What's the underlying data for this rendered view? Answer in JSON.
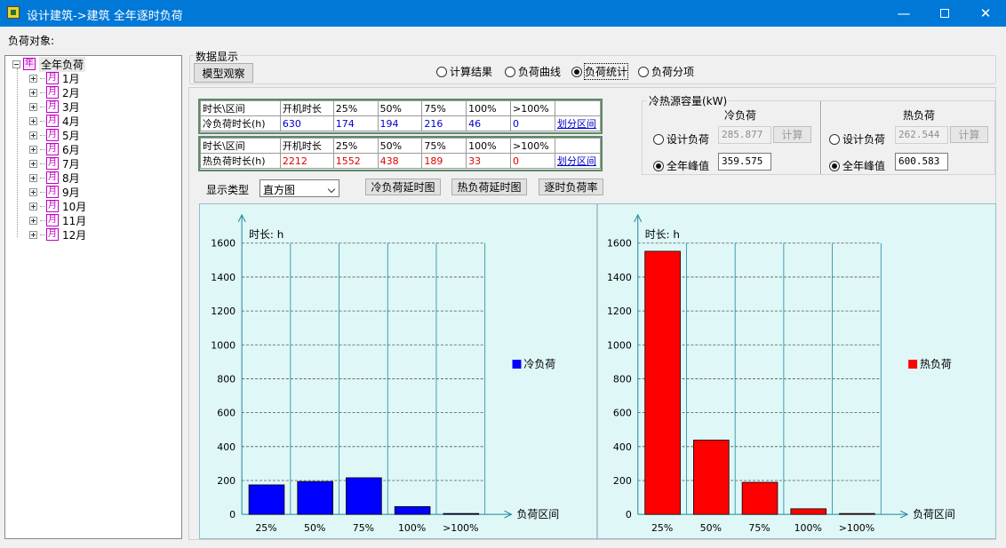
{
  "window": {
    "title": "设计建筑->建筑 全年逐时负荷"
  },
  "load_object_label": "负荷对象:",
  "tree": {
    "root": "全年负荷",
    "root_icon": "年",
    "month_icon": "月",
    "months": [
      "1月",
      "2月",
      "3月",
      "4月",
      "5月",
      "6月",
      "7月",
      "8月",
      "9月",
      "10月",
      "11月",
      "12月"
    ]
  },
  "data_display": {
    "group_title": "数据显示",
    "model_button": "模型观察",
    "options": [
      "计算结果",
      "负荷曲线",
      "负荷统计",
      "负荷分项"
    ],
    "selected": "负荷统计"
  },
  "cool_table": {
    "headers": [
      "时长\\区间",
      "开机时长",
      "25%",
      "50%",
      "75%",
      "100%",
      ">100%",
      ""
    ],
    "row_label": "冷负荷时长(h)",
    "values": [
      "630",
      "174",
      "194",
      "216",
      "46",
      "0"
    ],
    "link": "划分区间",
    "color": "#0000cc"
  },
  "heat_table": {
    "headers": [
      "时长\\区间",
      "开机时长",
      "25%",
      "50%",
      "75%",
      "100%",
      ">100%",
      ""
    ],
    "row_label": "热负荷时长(h)",
    "values": [
      "2212",
      "1552",
      "438",
      "189",
      "33",
      "0"
    ],
    "link": "划分区间",
    "color": "#e00000"
  },
  "capacity": {
    "title": "冷热源容量(kW)",
    "cool": {
      "heading": "冷负荷",
      "design_label": "设计负荷",
      "design_value": "285.877",
      "calc_button": "计算",
      "peak_label": "全年峰值",
      "peak_value": "359.575",
      "selected": "全年峰值"
    },
    "heat": {
      "heading": "热负荷",
      "design_label": "设计负荷",
      "design_value": "262.544",
      "calc_button": "计算",
      "peak_label": "全年峰值",
      "peak_value": "600.583",
      "selected": "全年峰值"
    }
  },
  "display_type": {
    "label": "显示类型",
    "value": "直方图"
  },
  "buttons": {
    "cool_delay": "冷负荷延时图",
    "heat_delay": "热负荷延时图",
    "hourly_rate": "逐时负荷率"
  },
  "chart_data": [
    {
      "type": "bar",
      "categories": [
        "25%",
        "50%",
        "75%",
        "100%",
        ">100%"
      ],
      "series": [
        {
          "name": "冷负荷",
          "values": [
            174,
            194,
            216,
            46,
            0
          ],
          "color": "#0000ff"
        }
      ],
      "ylabel": "时长: h",
      "xlabel": "负荷区间",
      "ylim": [
        0,
        1600
      ],
      "yticks": [
        0,
        200,
        400,
        600,
        800,
        1000,
        1200,
        1400,
        1600
      ],
      "grid": true,
      "legend": "right"
    },
    {
      "type": "bar",
      "categories": [
        "25%",
        "50%",
        "75%",
        "100%",
        ">100%"
      ],
      "series": [
        {
          "name": "热负荷",
          "values": [
            1552,
            438,
            189,
            33,
            0
          ],
          "color": "#ff0000"
        }
      ],
      "ylabel": "时长: h",
      "xlabel": "负荷区间",
      "ylim": [
        0,
        1600
      ],
      "yticks": [
        0,
        200,
        400,
        600,
        800,
        1000,
        1200,
        1400,
        1600
      ],
      "grid": true,
      "legend": "right"
    }
  ]
}
